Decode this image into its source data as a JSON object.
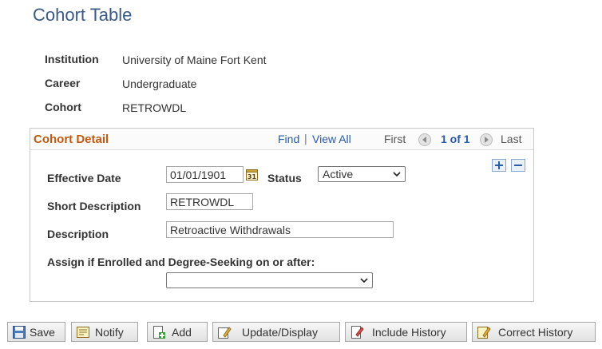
{
  "page": {
    "title": "Cohort Table"
  },
  "info": {
    "institution_label": "Institution",
    "institution_value": "University of Maine Fort Kent",
    "career_label": "Career",
    "career_value": "Undergraduate",
    "cohort_label": "Cohort",
    "cohort_value": "RETROWDL"
  },
  "panel": {
    "title": "Cohort Detail",
    "find": "Find",
    "separator": "|",
    "view_all": "View All",
    "first": "First",
    "count": "1 of 1",
    "last": "Last"
  },
  "form": {
    "effective_date_label": "Effective Date",
    "effective_date_value": "01/01/1901",
    "status_label": "Status",
    "status_value": "Active",
    "short_desc_label": "Short Description",
    "short_desc_value": "RETROWDL",
    "desc_label": "Description",
    "desc_value": "Retroactive Withdrawals",
    "assign_label": "Assign if Enrolled and Degree-Seeking on or after:",
    "assign_value": ""
  },
  "toolbar": {
    "save": "Save",
    "notify": "Notify",
    "add": "Add",
    "update_display": "Update/Display",
    "include_history": "Include History",
    "correct_history": "Correct History"
  },
  "icons": {
    "calendar": "calendar-icon",
    "add_row": "plus-icon",
    "delete_row": "minus-icon",
    "save": "floppy-disk-icon",
    "notify": "note-icon",
    "add": "add-document-icon",
    "update": "pencil-icon",
    "include_history": "history-icon",
    "correct_history": "correct-history-icon"
  },
  "colors": {
    "title": "#3a5a84",
    "panel_title": "#c05a12",
    "link": "#2a5aa8"
  }
}
